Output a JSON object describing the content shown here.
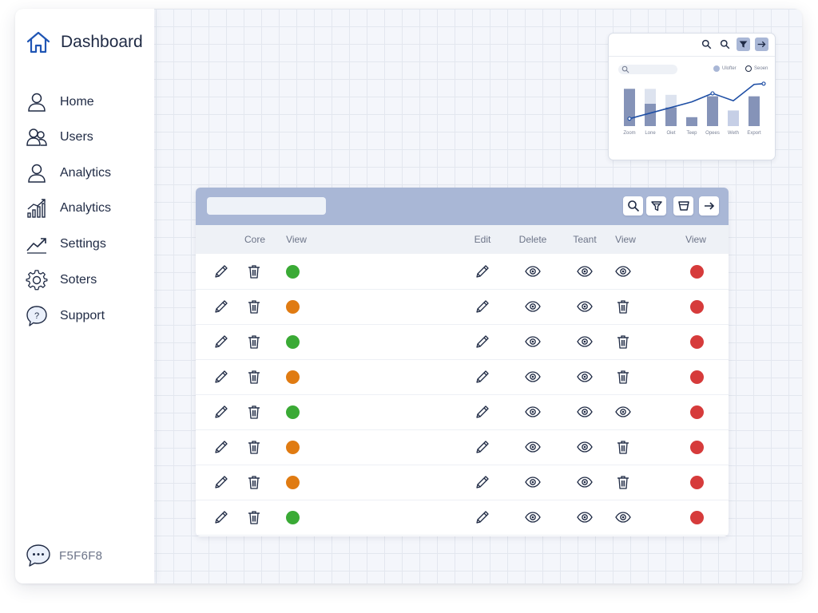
{
  "sidebar": {
    "title": "Dashboard",
    "items": [
      {
        "label": "Home",
        "icon": "user-icon"
      },
      {
        "label": "Users",
        "icon": "users-icon"
      },
      {
        "label": "Analytics",
        "icon": "user-icon"
      },
      {
        "label": "Analytics",
        "icon": "bar-chart-icon"
      },
      {
        "label": "Settings",
        "icon": "trend-line-icon"
      },
      {
        "label": "Soters",
        "icon": "gear-icon"
      },
      {
        "label": "Support",
        "icon": "help-bubble-icon"
      }
    ],
    "footer_text": "F5F6F8"
  },
  "chart_card": {
    "legend": [
      {
        "label": "Ulofter",
        "filled": true
      },
      {
        "label": "Seoen",
        "filled": false
      }
    ]
  },
  "chart_data": {
    "type": "bar",
    "categories": [
      "Zoom",
      "Lone",
      "Oiet",
      "Teep",
      "Opees",
      "Weth",
      "Export"
    ],
    "series": [
      {
        "type": "bar",
        "values": [
          [
            100,
            100
          ],
          [
            100,
            60
          ],
          [
            84,
            50
          ],
          [
            0,
            24
          ],
          [
            80,
            80
          ],
          [
            0,
            42
          ],
          [
            0,
            80
          ]
        ]
      },
      {
        "type": "line",
        "values": [
          20,
          35,
          50,
          65,
          88,
          68,
          112
        ]
      }
    ],
    "ylim": [
      0,
      120
    ],
    "grid": false,
    "legend": "top-right"
  },
  "table": {
    "search_value": "",
    "columns": [
      "Core",
      "View",
      "Edit",
      "Delete",
      "Teant",
      "View",
      "View"
    ],
    "rows": [
      {
        "status": "#3aaa35",
        "a7": "eye",
        "end": "#d63b3b"
      },
      {
        "status": "#e07b12",
        "a7": "trash",
        "end": "#d63b3b"
      },
      {
        "status": "#3aaa35",
        "a7": "trash",
        "end": "#d63b3b"
      },
      {
        "status": "#e07b12",
        "a7": "trash",
        "end": "#d63b3b"
      },
      {
        "status": "#3aaa35",
        "a7": "eye",
        "end": "#d63b3b"
      },
      {
        "status": "#e07b12",
        "a7": "trash",
        "end": "#d63b3b"
      },
      {
        "status": "#e07b12",
        "a7": "trash",
        "end": "#d63b3b"
      },
      {
        "status": "#3aaa35",
        "a7": "eye",
        "end": "#d63b3b"
      }
    ]
  },
  "colors": {
    "accent": "#1f55b4",
    "toolbar": "#a9b7d6",
    "bar_light": "#dde3ef",
    "bar_mid": "#aeb9d6",
    "bar_dark": "#8593b8",
    "line": "#1f4fa5"
  }
}
